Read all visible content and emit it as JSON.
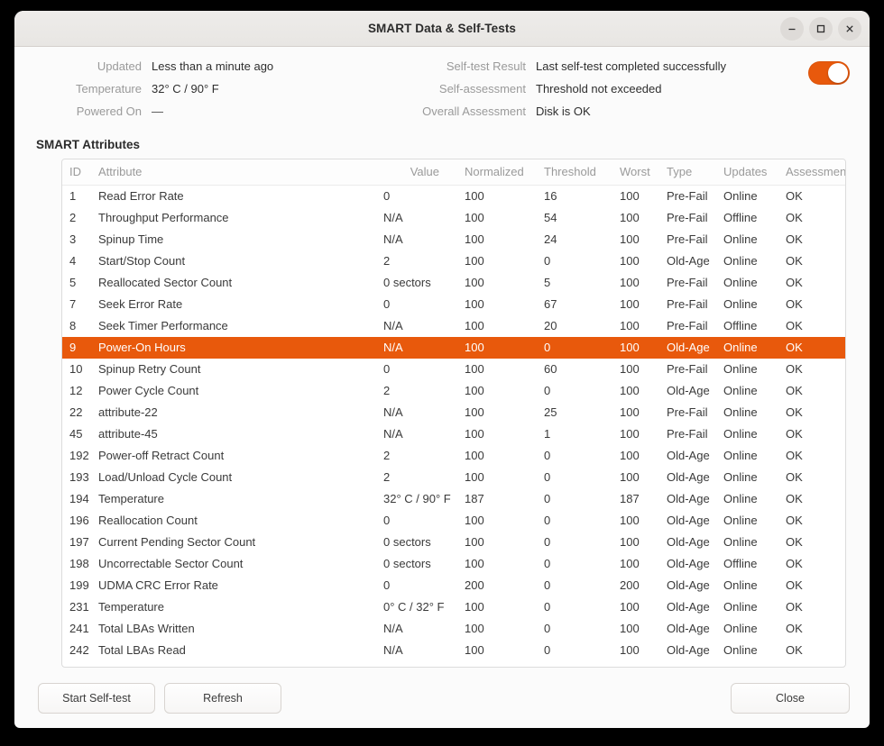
{
  "window": {
    "title": "SMART Data & Self-Tests",
    "controls": [
      {
        "name": "minimize",
        "glyph": "−"
      },
      {
        "name": "maximize",
        "glyph": "□"
      },
      {
        "name": "close",
        "glyph": "×"
      }
    ],
    "accent_color": "#e8590c"
  },
  "summary": {
    "left": [
      {
        "label": "Updated",
        "value": "Less than a minute ago"
      },
      {
        "label": "Temperature",
        "value": "32° C / 90° F"
      },
      {
        "label": "Powered On",
        "value": "—"
      }
    ],
    "right": [
      {
        "label": "Self-test Result",
        "value": "Last self-test completed successfully"
      },
      {
        "label": "Self-assessment",
        "value": "Threshold not exceeded"
      },
      {
        "label": "Overall Assessment",
        "value": "Disk is OK"
      }
    ],
    "toggle": {
      "name": "smart-enabled-toggle",
      "state": "on"
    }
  },
  "section": {
    "title": "SMART Attributes"
  },
  "table": {
    "columns": [
      "ID",
      "Attribute",
      "Value",
      "Normalized",
      "Threshold",
      "Worst",
      "Type",
      "Updates",
      "Assessment"
    ],
    "selected_row_index": 7,
    "rows": [
      {
        "id": "1",
        "attribute": "Read Error Rate",
        "value": "0",
        "normalized": "100",
        "threshold": "16",
        "worst": "100",
        "type": "Pre-Fail",
        "updates": "Online",
        "assessment": "OK"
      },
      {
        "id": "2",
        "attribute": "Throughput Performance",
        "value": "N/A",
        "normalized": "100",
        "threshold": "54",
        "worst": "100",
        "type": "Pre-Fail",
        "updates": "Offline",
        "assessment": "OK"
      },
      {
        "id": "3",
        "attribute": "Spinup Time",
        "value": "N/A",
        "normalized": "100",
        "threshold": "24",
        "worst": "100",
        "type": "Pre-Fail",
        "updates": "Online",
        "assessment": "OK"
      },
      {
        "id": "4",
        "attribute": "Start/Stop Count",
        "value": "2",
        "normalized": "100",
        "threshold": "0",
        "worst": "100",
        "type": "Old-Age",
        "updates": "Online",
        "assessment": "OK"
      },
      {
        "id": "5",
        "attribute": "Reallocated Sector Count",
        "value": "0 sectors",
        "normalized": "100",
        "threshold": "5",
        "worst": "100",
        "type": "Pre-Fail",
        "updates": "Online",
        "assessment": "OK"
      },
      {
        "id": "7",
        "attribute": "Seek Error Rate",
        "value": "0",
        "normalized": "100",
        "threshold": "67",
        "worst": "100",
        "type": "Pre-Fail",
        "updates": "Online",
        "assessment": "OK"
      },
      {
        "id": "8",
        "attribute": "Seek Timer Performance",
        "value": "N/A",
        "normalized": "100",
        "threshold": "20",
        "worst": "100",
        "type": "Pre-Fail",
        "updates": "Offline",
        "assessment": "OK"
      },
      {
        "id": "9",
        "attribute": "Power-On Hours",
        "value": "N/A",
        "normalized": "100",
        "threshold": "0",
        "worst": "100",
        "type": "Old-Age",
        "updates": "Online",
        "assessment": "OK"
      },
      {
        "id": "10",
        "attribute": "Spinup Retry Count",
        "value": "0",
        "normalized": "100",
        "threshold": "60",
        "worst": "100",
        "type": "Pre-Fail",
        "updates": "Online",
        "assessment": "OK"
      },
      {
        "id": "12",
        "attribute": "Power Cycle Count",
        "value": "2",
        "normalized": "100",
        "threshold": "0",
        "worst": "100",
        "type": "Old-Age",
        "updates": "Online",
        "assessment": "OK"
      },
      {
        "id": "22",
        "attribute": "attribute-22",
        "value": "N/A",
        "normalized": "100",
        "threshold": "25",
        "worst": "100",
        "type": "Pre-Fail",
        "updates": "Online",
        "assessment": "OK"
      },
      {
        "id": "45",
        "attribute": "attribute-45",
        "value": "N/A",
        "normalized": "100",
        "threshold": "1",
        "worst": "100",
        "type": "Pre-Fail",
        "updates": "Online",
        "assessment": "OK"
      },
      {
        "id": "192",
        "attribute": "Power-off Retract Count",
        "value": "2",
        "normalized": "100",
        "threshold": "0",
        "worst": "100",
        "type": "Old-Age",
        "updates": "Online",
        "assessment": "OK"
      },
      {
        "id": "193",
        "attribute": "Load/Unload Cycle Count",
        "value": "2",
        "normalized": "100",
        "threshold": "0",
        "worst": "100",
        "type": "Old-Age",
        "updates": "Online",
        "assessment": "OK"
      },
      {
        "id": "194",
        "attribute": "Temperature",
        "value": "32° C / 90° F",
        "normalized": "187",
        "threshold": "0",
        "worst": "187",
        "type": "Old-Age",
        "updates": "Online",
        "assessment": "OK"
      },
      {
        "id": "196",
        "attribute": "Reallocation Count",
        "value": "0",
        "normalized": "100",
        "threshold": "0",
        "worst": "100",
        "type": "Old-Age",
        "updates": "Online",
        "assessment": "OK"
      },
      {
        "id": "197",
        "attribute": "Current Pending Sector Count",
        "value": "0 sectors",
        "normalized": "100",
        "threshold": "0",
        "worst": "100",
        "type": "Old-Age",
        "updates": "Online",
        "assessment": "OK"
      },
      {
        "id": "198",
        "attribute": "Uncorrectable Sector Count",
        "value": "0 sectors",
        "normalized": "100",
        "threshold": "0",
        "worst": "100",
        "type": "Old-Age",
        "updates": "Offline",
        "assessment": "OK"
      },
      {
        "id": "199",
        "attribute": "UDMA CRC Error Rate",
        "value": "0",
        "normalized": "200",
        "threshold": "0",
        "worst": "200",
        "type": "Old-Age",
        "updates": "Online",
        "assessment": "OK"
      },
      {
        "id": "231",
        "attribute": "Temperature",
        "value": "0° C / 32° F",
        "normalized": "100",
        "threshold": "0",
        "worst": "100",
        "type": "Old-Age",
        "updates": "Online",
        "assessment": "OK"
      },
      {
        "id": "241",
        "attribute": "Total LBAs Written",
        "value": "N/A",
        "normalized": "100",
        "threshold": "0",
        "worst": "100",
        "type": "Old-Age",
        "updates": "Online",
        "assessment": "OK"
      },
      {
        "id": "242",
        "attribute": "Total LBAs Read",
        "value": "N/A",
        "normalized": "100",
        "threshold": "0",
        "worst": "100",
        "type": "Old-Age",
        "updates": "Online",
        "assessment": "OK"
      }
    ]
  },
  "footer": {
    "start_self_test": "Start Self-test",
    "refresh": "Refresh",
    "close": "Close"
  }
}
